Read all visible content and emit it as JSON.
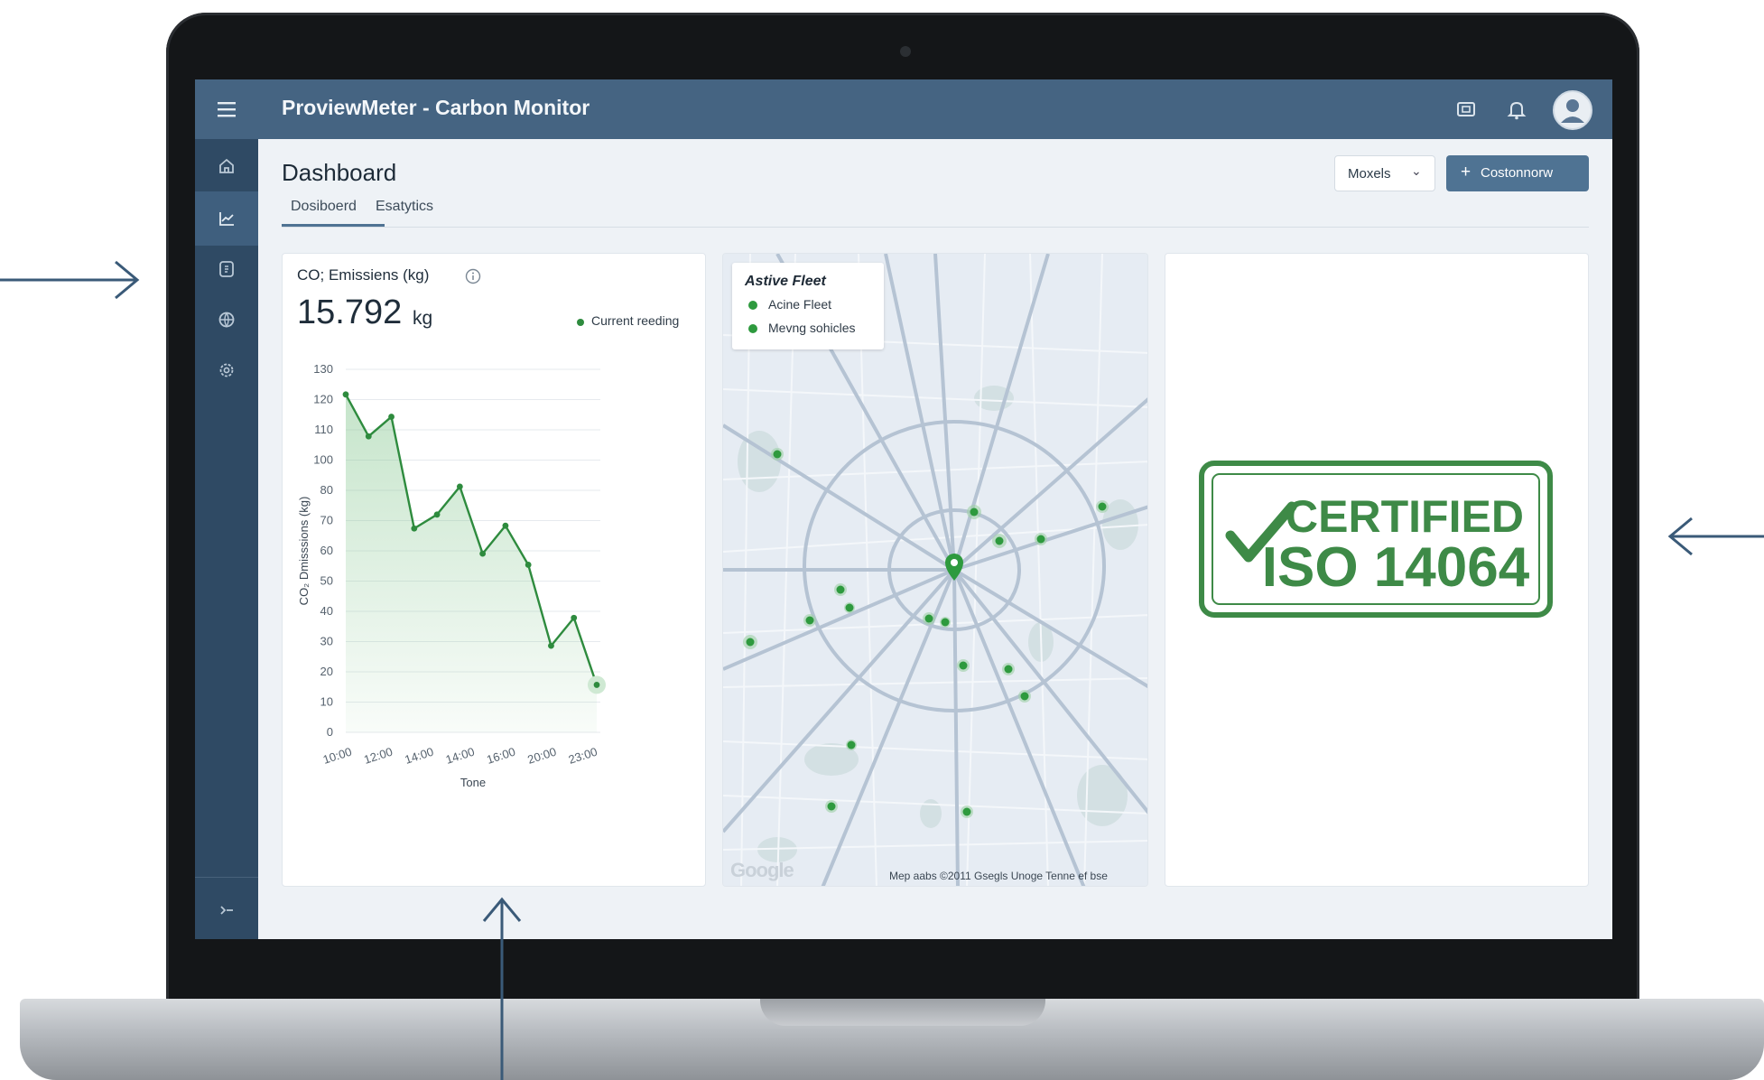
{
  "app": {
    "title": "ProviewMeter - Carbon Monitor"
  },
  "header": {
    "page_title": "Dashboard",
    "models_select": "Moxels",
    "primary_button": "Costonnorw",
    "tabs": [
      {
        "label": "Dosiboerd",
        "active": true
      },
      {
        "label": "Esatytics",
        "active": false
      }
    ]
  },
  "chart_card": {
    "title": "CO; Emissiens (kg)",
    "reading_value": "15.792",
    "reading_unit": "kg",
    "legend_label": "Current reeding"
  },
  "chart_data": {
    "type": "line",
    "title": "CO; Emissiens (kg)",
    "xlabel": "Tone",
    "ylabel": "CO₂ Dmisssions (kg)",
    "y_ticks": [
      "0",
      "10",
      "20",
      "30",
      "40",
      "50",
      "60",
      "70",
      "80",
      "100",
      "110",
      "120",
      "130"
    ],
    "x_ticks": [
      "10:00",
      "12:00",
      "14:00",
      "14:00",
      "16:00",
      "20:00",
      "23:00"
    ],
    "ylim": [
      0,
      130
    ],
    "grid": true,
    "series": [
      {
        "name": "Current reeding",
        "color": "#2e8b3e",
        "values": [
          121,
          106,
          113,
          73,
          78,
          88,
          64,
          74,
          60,
          31,
          41,
          17
        ]
      }
    ]
  },
  "map": {
    "legend_title": "Astive Fleet",
    "legend_items": [
      "Acine Fleet",
      "Mevng sohicles"
    ],
    "attribution_logo": "Google",
    "attribution": "Mep aabs ©2011 Gsegls Unoge     Tenne ef bse",
    "marker_color": "#2e9a3e"
  },
  "certification": {
    "line1": "CERTIFIED",
    "line2": "ISO 14064",
    "color": "#3e8a47"
  },
  "icons": {
    "topbar": [
      "menu-icon",
      "cast-icon",
      "bell-icon",
      "user-avatar-icon"
    ],
    "sidebar": [
      "home-icon",
      "chart-icon",
      "document-icon",
      "globe-icon",
      "settings-icon",
      "collapse-icon"
    ]
  }
}
